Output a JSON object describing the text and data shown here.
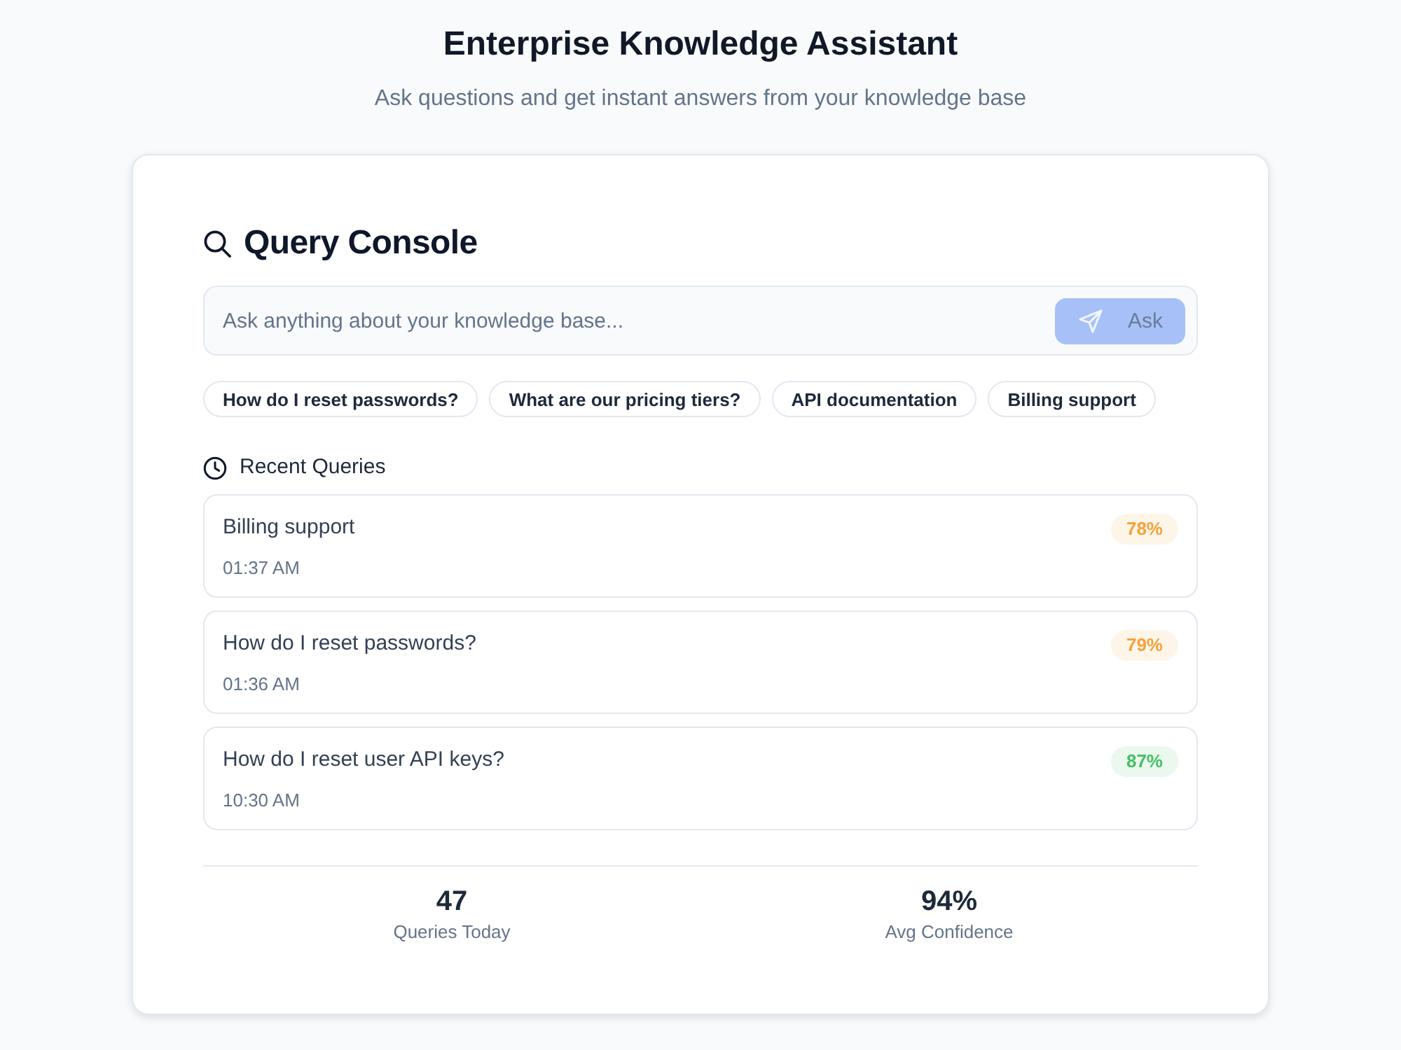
{
  "header": {
    "title": "Enterprise Knowledge Assistant",
    "subtitle": "Ask questions and get instant answers from your knowledge base"
  },
  "console": {
    "title": "Query Console",
    "search": {
      "placeholder": "Ask anything about your knowledge base...",
      "button": {
        "label": "Ask",
        "disabled": true
      }
    },
    "suggestions": [
      "How do I reset passwords?",
      "What are our pricing tiers?",
      "API documentation",
      "Billing support"
    ],
    "recent": {
      "title": "Recent Queries",
      "items": [
        {
          "query": "Billing support",
          "time": "01:37 AM",
          "confidence": "78%",
          "color": "#f2a33a"
        },
        {
          "query": "How do I reset passwords?",
          "time": "01:36 AM",
          "confidence": "79%",
          "color": "#f2a33a"
        },
        {
          "query": "How do I reset user API keys?",
          "time": "10:30 AM",
          "confidence": "87%",
          "color": "#45bf66"
        }
      ]
    },
    "stats": [
      {
        "value": "47",
        "label": "Queries Today"
      },
      {
        "value": "94%",
        "label": "Avg Confidence"
      }
    ]
  }
}
